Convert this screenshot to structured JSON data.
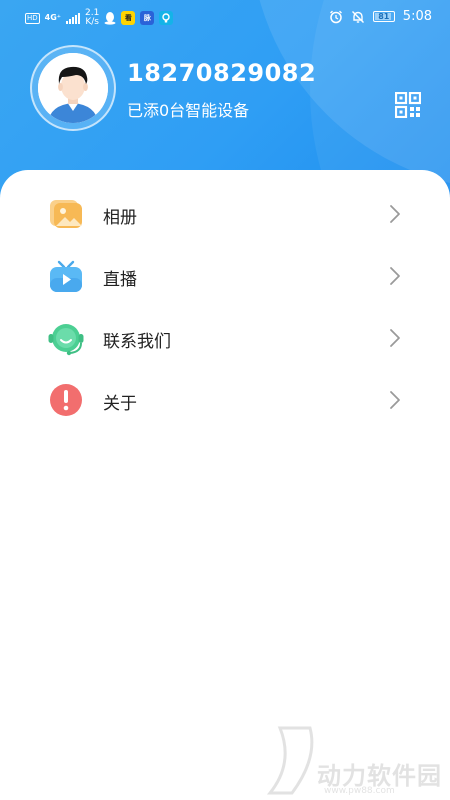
{
  "status_bar": {
    "network_type": "4G⁺",
    "speed_value": "2.1",
    "speed_unit": "K/s",
    "app_badge_1": "看",
    "app_badge_2": "脉",
    "battery_level": "81",
    "time": "5:08"
  },
  "profile": {
    "phone": "18270829082",
    "device_summary": "已添0台智能设备"
  },
  "menu": [
    {
      "label": "相册",
      "icon": "photo-album-icon"
    },
    {
      "label": "直播",
      "icon": "tv-live-icon"
    },
    {
      "label": "联系我们",
      "icon": "headset-support-icon"
    },
    {
      "label": "关于",
      "icon": "exclamation-info-icon"
    }
  ],
  "watermark": {
    "text": "动力软件园",
    "url": "www.pw88.com"
  },
  "colors": {
    "header_blue": "#2f9ef4",
    "album_yellow": "#f9c66a",
    "live_blue": "#5ab9f5",
    "support_green": "#4ccf93",
    "about_red": "#f06a6a"
  }
}
